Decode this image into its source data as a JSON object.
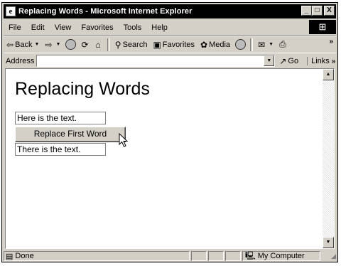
{
  "window": {
    "title": "Replacing Words - Microsoft Internet Explorer",
    "controls": {
      "minimize": "_",
      "maximize": "□",
      "close": "X"
    }
  },
  "menubar": {
    "items": [
      "File",
      "Edit",
      "View",
      "Favorites",
      "Tools",
      "Help"
    ]
  },
  "toolbar": {
    "back_label": "Back",
    "search_label": "Search",
    "favorites_label": "Favorites",
    "media_label": "Media"
  },
  "addressbar": {
    "label": "Address",
    "value": "",
    "go_label": "Go",
    "links_label": "Links"
  },
  "page": {
    "title": "Replacing Words",
    "input1_value": "Here is the text.",
    "button_label": "Replace First Word",
    "input2_value": "There is the text."
  },
  "statusbar": {
    "status_text": "Done",
    "zone_text": "My Computer"
  },
  "icons": {
    "back": "back-arrow-icon",
    "forward": "forward-arrow-icon",
    "stop": "stop-icon",
    "refresh": "refresh-icon",
    "home": "home-icon",
    "search": "search-icon",
    "favorites": "favorites-icon",
    "media": "media-icon",
    "history": "history-icon",
    "mail": "mail-icon",
    "print": "print-icon",
    "go": "go-arrow-icon",
    "cursor": "mouse-pointer-icon"
  }
}
